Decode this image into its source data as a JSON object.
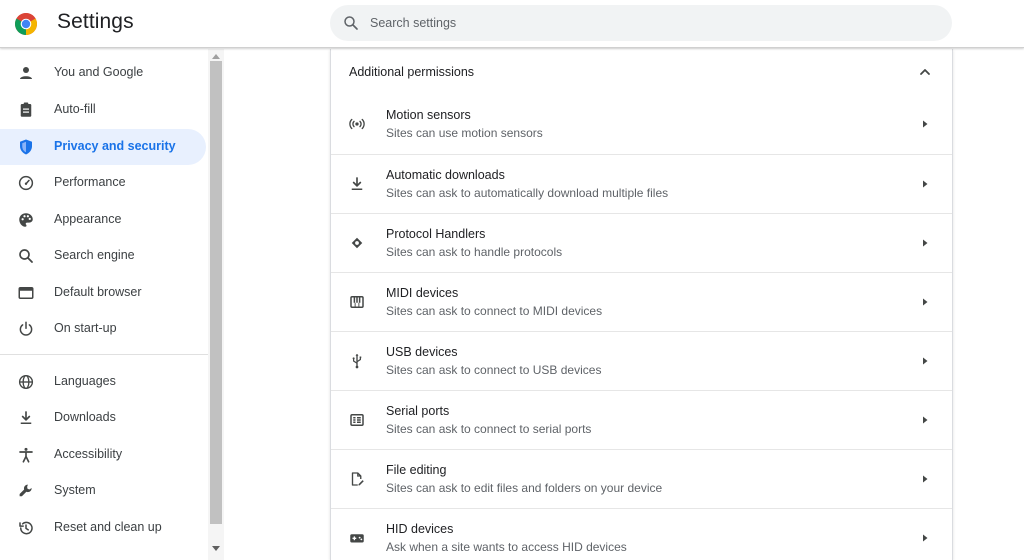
{
  "header": {
    "title": "Settings",
    "search_placeholder": "Search settings"
  },
  "sidebar": {
    "items": [
      {
        "label": "You and Google",
        "icon": "person-icon"
      },
      {
        "label": "Auto-fill",
        "icon": "clipboard-icon"
      },
      {
        "label": "Privacy and security",
        "icon": "shield-icon",
        "active": true
      },
      {
        "label": "Performance",
        "icon": "speedometer-icon"
      },
      {
        "label": "Appearance",
        "icon": "palette-icon"
      },
      {
        "label": "Search engine",
        "icon": "search-icon"
      },
      {
        "label": "Default browser",
        "icon": "browser-window-icon"
      },
      {
        "label": "On start-up",
        "icon": "power-icon"
      },
      {
        "label": "Languages",
        "icon": "globe-icon"
      },
      {
        "label": "Downloads",
        "icon": "download-icon"
      },
      {
        "label": "Accessibility",
        "icon": "accessibility-icon"
      },
      {
        "label": "System",
        "icon": "wrench-icon"
      },
      {
        "label": "Reset and clean up",
        "icon": "history-icon"
      }
    ]
  },
  "main": {
    "section_title": "Additional permissions",
    "rows": [
      {
        "title": "Motion sensors",
        "subtitle": "Sites can use motion sensors",
        "icon": "sensor-icon"
      },
      {
        "title": "Automatic downloads",
        "subtitle": "Sites can ask to automatically download multiple files",
        "icon": "download-icon"
      },
      {
        "title": "Protocol Handlers",
        "subtitle": "Sites can ask to handle protocols",
        "icon": "protocol-icon"
      },
      {
        "title": "MIDI devices",
        "subtitle": "Sites can ask to connect to MIDI devices",
        "icon": "piano-icon"
      },
      {
        "title": "USB devices",
        "subtitle": "Sites can ask to connect to USB devices",
        "icon": "usb-icon"
      },
      {
        "title": "Serial ports",
        "subtitle": "Sites can ask to connect to serial ports",
        "icon": "serial-port-icon"
      },
      {
        "title": "File editing",
        "subtitle": "Sites can ask to edit files and folders on your device",
        "icon": "file-edit-icon"
      },
      {
        "title": "HID devices",
        "subtitle": "Ask when a site wants to access HID devices",
        "icon": "gamepad-icon"
      }
    ]
  },
  "colors": {
    "accent": "#1a73e8",
    "active_bg": "#e8f0fe",
    "search_bg": "#f1f3f4"
  }
}
